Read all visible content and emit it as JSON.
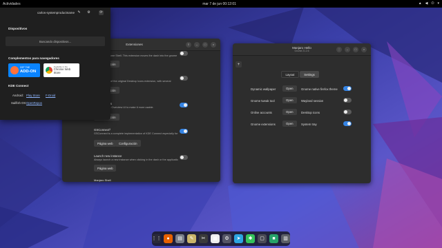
{
  "topbar": {
    "activities": "Actividades",
    "clock": "mar 7 de jun 00:12:01"
  },
  "popup": {
    "title": "carlos-systemproductname",
    "devices_heading": "Dispositivos",
    "searching": "Buscando dispositivos...",
    "browsers_heading": "Complementos para navegadores",
    "firefox_badge_top": "GET THE",
    "firefox_badge_main": "ADD-ON",
    "chrome_badge_top": "Available in the",
    "chrome_badge_main": "Chrome Web Store",
    "kde_heading": "KDE Connect",
    "android_label": "Android:",
    "play_store": "Play Store",
    "fdroid": "F-Droid",
    "sailfish_label": "Sailfish OS:",
    "openrepos": "OpenRepos"
  },
  "extensions": {
    "title": "Extensiones",
    "rows": [
      {
        "title": "",
        "desc": "ons to the Gnome Shell. This extension moves the dash into the gnome",
        "buttons": [
          "Configuración"
        ],
        "on": false
      },
      {
        "title": "NG (DING)",
        "desc": "desktop. Fork of the original Desktop Icons extension, with several",
        "buttons": [
          "Configuración"
        ],
        "on": false
      },
      {
        "title": "mprovements",
        "desc": "to GNOME 3's Overview UI to make it more usable.",
        "buttons": [
          "Configuración"
        ],
        "on": true
      },
      {
        "title": "GSConnect",
        "desc": "GSConnect is a complete implementation of KDE Connect especially for GNOME Shell...",
        "buttons": [
          "Página web",
          "Configuración"
        ],
        "on": true
      },
      {
        "title": "Launch new instance",
        "desc": "Always launch a new instance when clicking in the dash or the application view.",
        "buttons": [
          "Página web"
        ],
        "on": false
      },
      {
        "title": "Manjaro Shell",
        "desc": "",
        "buttons": [],
        "on": false
      }
    ],
    "badge": "3"
  },
  "hello": {
    "title": "Manjaro Hello",
    "subtitle": "Gnome 21.2.6",
    "tab_layout": "Layout",
    "tab_settings": "Settings",
    "rows": [
      {
        "left_label": "Dynamic wallpaper",
        "left_btn": "Open",
        "right_label": "Gnome native firefox theme",
        "on": true
      },
      {
        "left_label": "Gnome tweak tool",
        "left_btn": "Open",
        "right_label": "Wayland session",
        "on": false
      },
      {
        "left_label": "Online accounts",
        "left_btn": "Open",
        "right_label": "Desktop icons",
        "on": false
      },
      {
        "left_label": "Gnome extensions",
        "left_btn": "Open",
        "right_label": "System tray",
        "on": true
      }
    ]
  },
  "dock": {
    "icons": [
      {
        "name": "app-grid-icon",
        "glyph": "⋮⋮",
        "color": "#2a2a3a"
      },
      {
        "name": "firefox-icon",
        "glyph": "●",
        "color": "#e66000"
      },
      {
        "name": "files-icon",
        "glyph": "▤",
        "color": "#7a7f8a"
      },
      {
        "name": "text-editor-icon",
        "glyph": "✎",
        "color": "#c9b46a"
      },
      {
        "name": "tools-icon",
        "glyph": "✂",
        "color": "#3a3a3a"
      },
      {
        "name": "libreoffice-icon",
        "glyph": "▦",
        "color": "#eeeeee"
      },
      {
        "name": "settings-icon",
        "glyph": "⚙",
        "color": "#555566"
      },
      {
        "name": "telegram-icon",
        "glyph": "➤",
        "color": "#2ca5e0"
      },
      {
        "name": "extensions-icon",
        "glyph": "✱",
        "color": "#34c35a"
      },
      {
        "name": "terminal-icon",
        "glyph": "▢",
        "color": "#4a4a55"
      },
      {
        "name": "manjaro-hello-icon",
        "glyph": "■",
        "color": "#26a269"
      },
      {
        "name": "trash-icon",
        "glyph": "▥",
        "color": "#5c5f66"
      }
    ]
  },
  "colors": {
    "accent": "#3584e4",
    "manjaro": "#35bf5c"
  }
}
